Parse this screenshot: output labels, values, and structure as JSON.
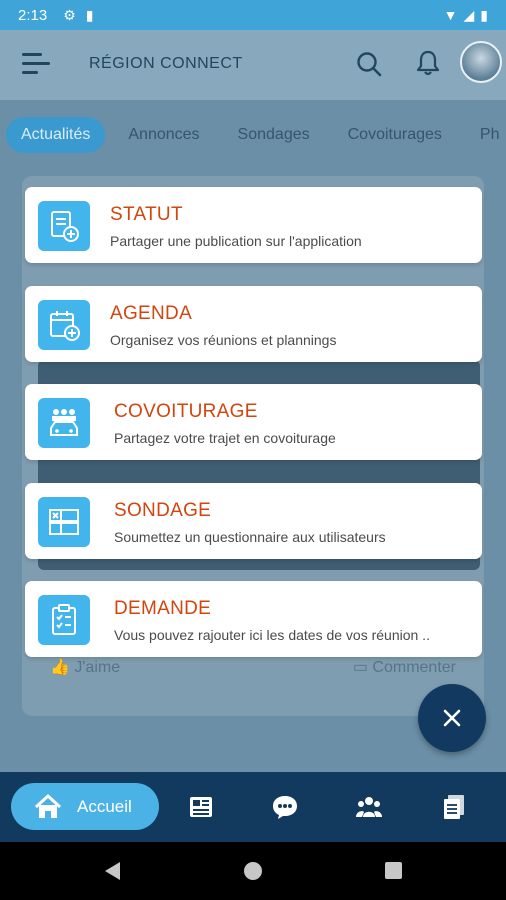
{
  "status_bar": {
    "time": "2:13"
  },
  "header": {
    "title": "RÉGION CONNECT"
  },
  "tabs": [
    {
      "label": "Actualités",
      "active": true
    },
    {
      "label": "Annonces"
    },
    {
      "label": "Sondages"
    },
    {
      "label": "Covoiturages"
    },
    {
      "label": "Ph"
    }
  ],
  "feed": {
    "like_label": "J'aime",
    "comment_label": "Commenter"
  },
  "menu": [
    {
      "title": "STATUT",
      "subtitle": "Partager une publication sur l'application",
      "icon": "document-add-icon"
    },
    {
      "title": "AGENDA",
      "subtitle": "Organisez vos réunions et plannings",
      "icon": "calendar-add-icon"
    },
    {
      "title": "COVOITURAGE",
      "subtitle": "Partagez votre trajet en covoiturage",
      "icon": "carpool-icon"
    },
    {
      "title": "SONDAGE",
      "subtitle": "Soumettez un questionnaire aux utilisateurs",
      "icon": "poll-icon"
    },
    {
      "title": "DEMANDE",
      "subtitle": "Vous pouvez rajouter ici les dates de vos réunion ..",
      "icon": "clipboard-check-icon"
    }
  ],
  "bottom_nav": {
    "home_label": "Accueil"
  },
  "colors": {
    "accent": "#42b6ec",
    "title_orange": "#d3450f",
    "navy": "#123a5f",
    "status_bar": "#3fa4d8"
  }
}
